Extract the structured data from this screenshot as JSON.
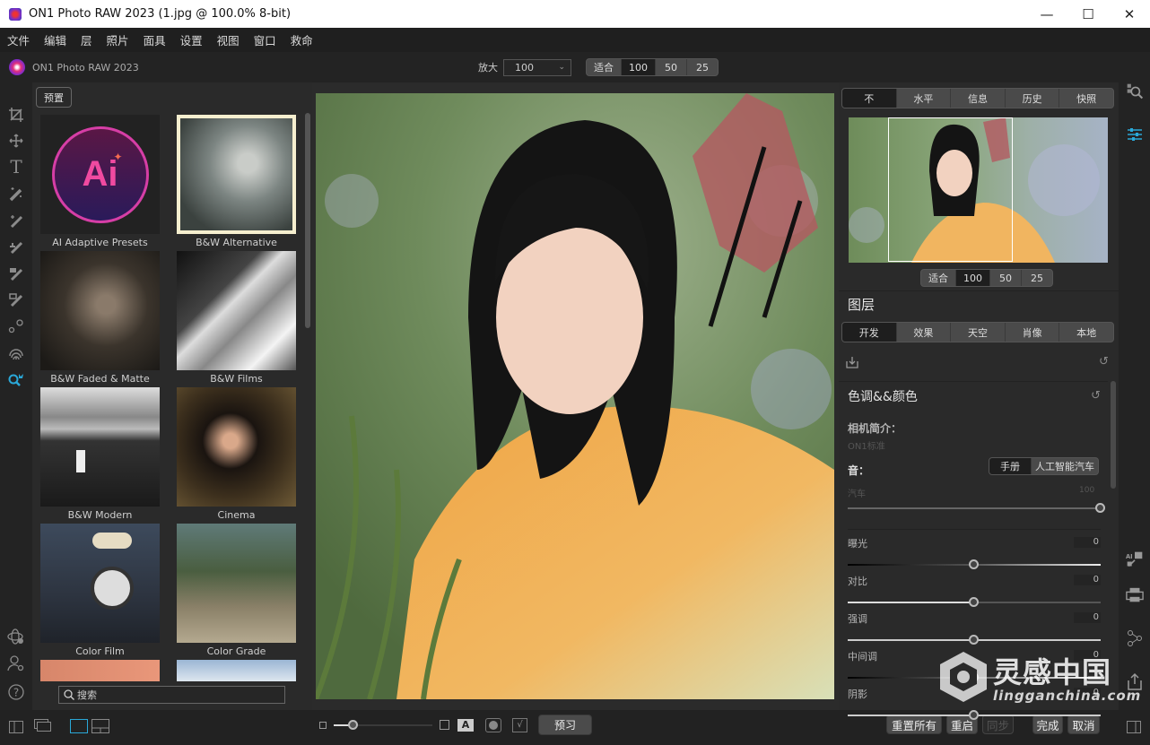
{
  "window": {
    "title": "ON1 Photo RAW 2023 (1.jpg @ 100.0% 8-bit)",
    "controls": {
      "minimize": "—",
      "maximize": "☐",
      "close": "✕"
    }
  },
  "menu": [
    "文件",
    "编辑",
    "层",
    "照片",
    "面具",
    "设置",
    "视图",
    "窗口",
    "救命"
  ],
  "topbar": {
    "brand": "ON1 Photo RAW 2023",
    "zoom_label": "放大",
    "zoom_value": "100",
    "zoom_presets": [
      "适合",
      "100",
      "50",
      "25"
    ],
    "zoom_active": "100"
  },
  "tools": [
    {
      "name": "crop-icon",
      "glyph": "⌗"
    },
    {
      "name": "move-icon",
      "glyph": "✥"
    },
    {
      "name": "text-icon",
      "glyph": "T"
    },
    {
      "name": "magic-wand-icon",
      "glyph": "⁄"
    },
    {
      "name": "retouch-brush-icon",
      "glyph": "⁄"
    },
    {
      "name": "clone-brush-icon",
      "glyph": "⁄"
    },
    {
      "name": "masking-brush-icon",
      "glyph": "⁄"
    },
    {
      "name": "refine-brush-icon",
      "glyph": "⁄"
    },
    {
      "name": "red-eye-icon",
      "glyph": "∘"
    },
    {
      "name": "fingerprint-icon",
      "glyph": "◎"
    },
    {
      "name": "ai-search-icon",
      "glyph": "🔍"
    }
  ],
  "rail_bottom": [
    {
      "name": "orbit-icon",
      "glyph": "⊛"
    },
    {
      "name": "user-settings-icon",
      "glyph": "⚇"
    },
    {
      "name": "help-icon",
      "glyph": "?"
    }
  ],
  "presets": {
    "button": "预置",
    "items": [
      {
        "label": "AI Adaptive Presets",
        "thumb": "ai"
      },
      {
        "label": "B&W Alternative",
        "thumb": "bw-alt"
      },
      {
        "label": "B&W Faded & Matte",
        "thumb": "bw-faded"
      },
      {
        "label": "B&W Films",
        "thumb": "bw-films"
      },
      {
        "label": "B&W Modern",
        "thumb": "bw-modern"
      },
      {
        "label": "Cinema",
        "thumb": "cinema"
      },
      {
        "label": "Color Film",
        "thumb": "color-film"
      },
      {
        "label": "Color Grade",
        "thumb": "color-grade"
      },
      {
        "label": "",
        "thumb": "orange"
      },
      {
        "label": "",
        "thumb": "sky"
      }
    ],
    "search_placeholder": "搜索"
  },
  "canvas_bottom": {
    "preview": "预习"
  },
  "right": {
    "nav_tabs": [
      "不",
      "水平",
      "信息",
      "历史",
      "快照"
    ],
    "nav_active": "不",
    "nav_zoom": [
      "适合",
      "100",
      "50",
      "25"
    ],
    "nav_zoom_active": "100",
    "layers_title": "图层",
    "module_tabs": [
      "开发",
      "效果",
      "天空",
      "肖像",
      "本地"
    ],
    "module_active": "开发",
    "section_title": "色调&&颜色",
    "camera_profile_label": "相机简介：",
    "camera_profile_value": "ON1标准",
    "tone_label": "音：",
    "tone_modes": [
      "手册",
      "人工智能汽车"
    ],
    "auto_label": "汽车",
    "auto_value": "100",
    "auto_fraction": 1.0,
    "sliders": [
      {
        "label": "曝光",
        "value": "0",
        "fraction": 0.5
      },
      {
        "label": "对比",
        "value": "0",
        "fraction": 0.5
      },
      {
        "label": "强调",
        "value": "0",
        "fraction": 0.5
      },
      {
        "label": "中间调",
        "value": "0",
        "fraction": 0.5
      },
      {
        "label": "阴影",
        "value": "0",
        "fraction": 0.5
      }
    ]
  },
  "footer": {
    "reset_all": "重置所有",
    "reset": "重启",
    "sync": "同步",
    "done": "完成",
    "cancel": "取消"
  },
  "watermark": {
    "cn": "灵感中国",
    "en": "lingganchina.com"
  }
}
